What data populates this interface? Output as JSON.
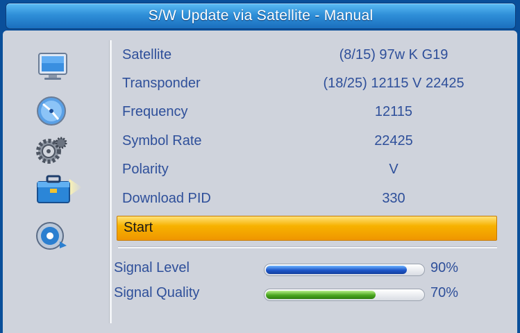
{
  "title": "S/W Update via Satellite - Manual",
  "sidebar": {
    "icons": [
      "tv-icon",
      "satellite-dish-icon",
      "settings-gear-icon",
      "toolbox-icon",
      "media-player-icon"
    ],
    "selected": "toolbox-icon"
  },
  "fields": [
    {
      "label": "Satellite",
      "value": "(8/15) 97w K G19"
    },
    {
      "label": "Transponder",
      "value": "(18/25) 12115 V 22425"
    },
    {
      "label": "Frequency",
      "value": "12115"
    },
    {
      "label": "Symbol Rate",
      "value": "22425"
    },
    {
      "label": "Polarity",
      "value": "V"
    },
    {
      "label": "Download PID",
      "value": "330"
    }
  ],
  "start_label": "Start",
  "signal": {
    "level": {
      "label": "Signal Level",
      "percent_text": "90%",
      "fraction": 0.9
    },
    "quality": {
      "label": "Signal Quality",
      "percent_text": "70%",
      "fraction": 0.7
    }
  },
  "colors": {
    "text": "#2e4f9a",
    "highlight": "#f7b200",
    "title_bar": "#2f8fd8",
    "level_bar": "#1d55c8",
    "quality_bar": "#4aa61f"
  }
}
